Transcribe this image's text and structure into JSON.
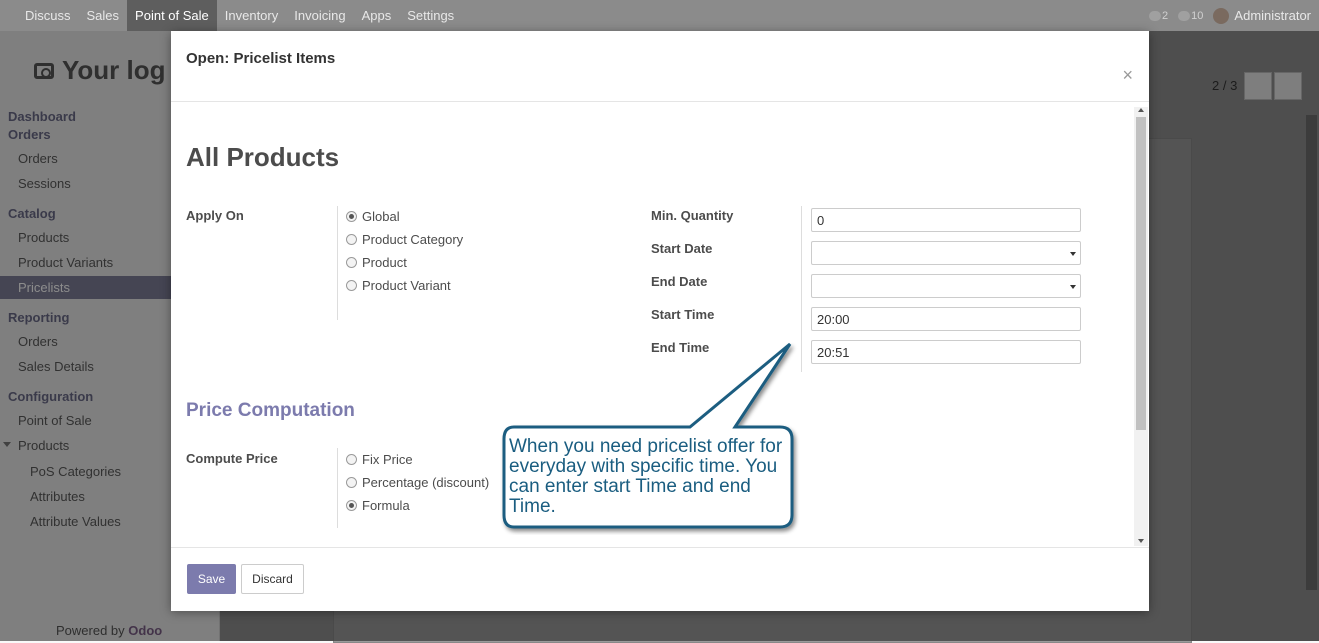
{
  "topbar": {
    "apps": [
      "Discuss",
      "Sales",
      "Point of Sale",
      "Inventory",
      "Invoicing",
      "Apps",
      "Settings"
    ],
    "active_app": "Point of Sale",
    "chat_count": "2",
    "activity_count": "10",
    "user": "Administrator"
  },
  "sidebar": {
    "logo_text": "Your log",
    "sections": {
      "dashboard": "Dashboard",
      "orders_head": "Orders",
      "orders": "Orders",
      "sessions": "Sessions",
      "catalog": "Catalog",
      "products": "Products",
      "product_variants": "Product Variants",
      "pricelists": "Pricelists",
      "reporting": "Reporting",
      "rep_orders": "Orders",
      "sales_details": "Sales Details",
      "configuration": "Configuration",
      "point_of_sale": "Point of Sale",
      "conf_products": "Products",
      "pos_categories": "PoS Categories",
      "attributes": "Attributes",
      "attribute_values": "Attribute Values"
    },
    "powered_by": "Powered by",
    "powered_brand": "Odoo"
  },
  "background": {
    "pager": "2 / 3"
  },
  "modal": {
    "title": "Open: Pricelist Items",
    "close": "×",
    "heading": "All Products",
    "apply_on_label": "Apply On",
    "apply_on_options": [
      "Global",
      "Product Category",
      "Product",
      "Product Variant"
    ],
    "apply_on_selected": "Global",
    "min_qty_label": "Min. Quantity",
    "min_qty_value": "0",
    "start_date_label": "Start Date",
    "start_date_value": "",
    "end_date_label": "End Date",
    "end_date_value": "",
    "start_time_label": "Start Time",
    "start_time_value": "20:00",
    "end_time_label": "End Time",
    "end_time_value": "20:51",
    "price_heading": "Price Computation",
    "compute_price_label": "Compute Price",
    "compute_options": [
      "Fix Price",
      "Percentage (discount)",
      "Formula"
    ],
    "compute_selected": "Formula",
    "save": "Save",
    "discard": "Discard"
  },
  "callout": {
    "text": "When you need pricelist offer for everyday with specific time. You can enter start Time and end Time."
  },
  "colors": {
    "accent": "#7c7bad",
    "callout_border": "#1a5d80"
  }
}
